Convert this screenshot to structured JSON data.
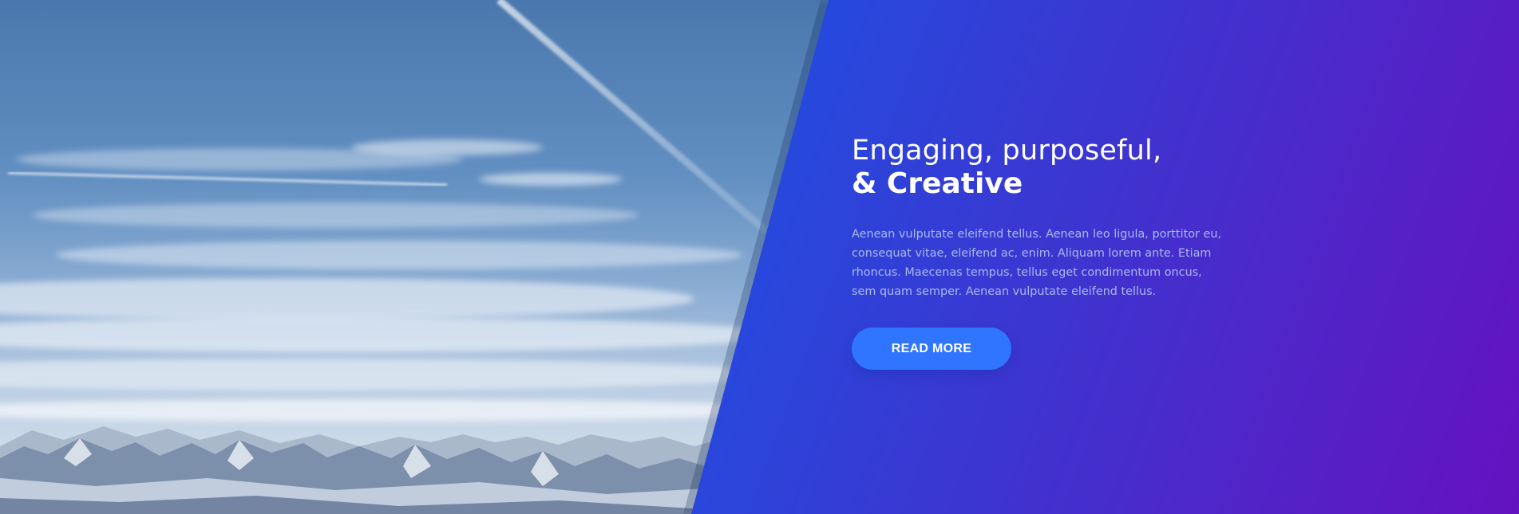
{
  "hero": {
    "headline_line1": "Engaging, purposeful,",
    "headline_line2": "& Creative",
    "body": "Aenean vulputate eleifend tellus. Aenean leo ligula, porttitor eu, consequat vitae, eleifend ac, enim. Aliquam lorem ante. Etiam rhoncus. Maecenas tempus, tellus eget condimentum oncus, sem quam semper. Aenean vulputate eleifend tellus.",
    "cta_label": "READ MORE"
  },
  "background_image": {
    "description_icon": "mountain-sky-photo"
  },
  "colors": {
    "gradient_start": "#1160ef",
    "gradient_end": "#6512c0",
    "button": "#2f75ff",
    "body_text": "#aab8ee",
    "headline": "#ffffff"
  }
}
